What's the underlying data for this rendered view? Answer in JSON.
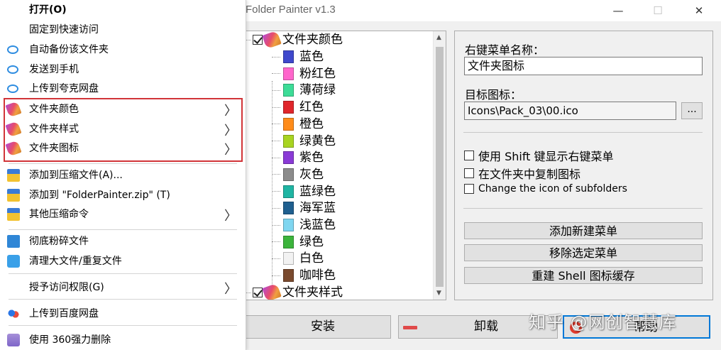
{
  "app": {
    "title": "Folder Painter v1.3",
    "window_buttons": {
      "minimize": "—",
      "maximize": "☐",
      "close": "✕"
    },
    "tree": {
      "parent1": "文件夹颜色",
      "children": [
        {
          "label": "蓝色",
          "color": "#3f48cc"
        },
        {
          "label": "粉红色",
          "color": "#ff66cc"
        },
        {
          "label": "薄荷绿",
          "color": "#3ddc97"
        },
        {
          "label": "红色",
          "color": "#e0262b"
        },
        {
          "label": "橙色",
          "color": "#ff8c1a"
        },
        {
          "label": "绿黄色",
          "color": "#a8d421"
        },
        {
          "label": "紫色",
          "color": "#8a3ad6"
        },
        {
          "label": "灰色",
          "color": "#8c8c8c"
        },
        {
          "label": "蓝绿色",
          "color": "#1fb5a3"
        },
        {
          "label": "海军蓝",
          "color": "#1f5f8f"
        },
        {
          "label": "浅蓝色",
          "color": "#7fd6f0"
        },
        {
          "label": "绿色",
          "color": "#3cb43c"
        },
        {
          "label": "白色",
          "color": "#f2f2f2"
        },
        {
          "label": "咖啡色",
          "color": "#7a4a2e"
        }
      ],
      "parent2": "文件夹样式"
    },
    "right": {
      "menu_name_label": "右键菜单名称：",
      "menu_name_value": "文件夹图标",
      "target_icon_label": "目标图标：",
      "target_icon_value": "Icons\\Pack_03\\00.ico",
      "browse_label": "...",
      "check_shift": "使用 Shift 键显示右键菜单",
      "check_copy": "在文件夹中复制图标",
      "check_subfolders": "Change the icon of subfolders",
      "btn_add": "添加新建菜单",
      "btn_remove": "移除选定菜单",
      "btn_rebuild": "重建 Shell 图标缓存"
    },
    "bottom": {
      "install": "安装",
      "uninstall": "卸载",
      "help": "帮助"
    }
  },
  "watermark": "知乎 @网创智慧库",
  "context_menu": {
    "items": [
      {
        "label": "打开(O)",
        "bold": true
      },
      {
        "label": "固定到快速访问"
      },
      {
        "label": "自动备份该文件夹",
        "icon": "cloud-icon"
      },
      {
        "label": "发送到手机",
        "icon": "cloud-icon"
      },
      {
        "label": "上传到夸克网盘",
        "icon": "cloud-icon"
      },
      {
        "label": "文件夹颜色",
        "icon": "brush-icon"
      },
      {
        "label": "文件夹样式",
        "icon": "brush-icon"
      },
      {
        "label": "文件夹图标",
        "icon": "brush-icon"
      },
      {
        "label": "添加到压缩文件(A)...",
        "icon": "zip-icon"
      },
      {
        "label": "添加到 \"FolderPainter.zip\" (T)",
        "icon": "zip-icon"
      },
      {
        "label": "其他压缩命令",
        "icon": "zip-icon"
      },
      {
        "label": "彻底粉碎文件",
        "icon": "shredder-icon"
      },
      {
        "label": "清理大文件/重复文件",
        "icon": "clean-icon"
      },
      {
        "label": "授予访问权限(G)"
      },
      {
        "label": "上传到百度网盘",
        "icon": "baidu-icon"
      },
      {
        "label": "使用 360强力删除",
        "icon": "360-icon"
      }
    ],
    "submenu_arrow": "〉"
  }
}
